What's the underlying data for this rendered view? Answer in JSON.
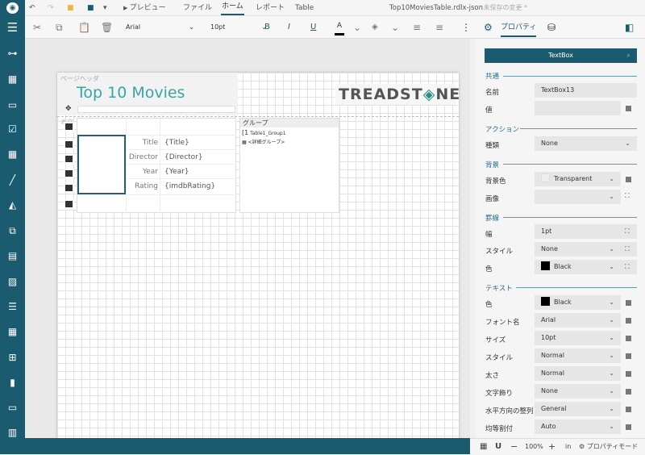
{
  "topbar": {
    "preview": "プレビュー",
    "tabs": [
      "ファイル",
      "ホーム",
      "レポート",
      "Table"
    ],
    "active_tab": "ホーム",
    "filename": "Top10MoviesTable.rdlx-json",
    "unsaved": "* 未保存の変更 *"
  },
  "toolbar": {
    "font": "Arial",
    "size": "10pt",
    "bold": "B",
    "italic": "I",
    "underline": "U"
  },
  "report": {
    "page_header_label": "ページヘッダ",
    "title": "Top 10 Movies",
    "logo": "TREADSTONE",
    "body_label": "本文",
    "rows": [
      {
        "label": "Title",
        "value": "{Title}"
      },
      {
        "label": "Director",
        "value": "{Director}"
      },
      {
        "label": "Year",
        "value": "{Year}"
      },
      {
        "label": "Rating",
        "value": "{imdbRating}"
      }
    ],
    "groups": {
      "header": "グループ",
      "group1": "Table1_Group1",
      "group1_prefix": "[1",
      "detail": "<詳細グループ>"
    }
  },
  "props": {
    "tab": "プロパティ",
    "object_type": "TextBox",
    "sections": {
      "common": "共通",
      "action": "アクション",
      "background": "背景",
      "border": "罫線",
      "text": "テキスト"
    },
    "name_label": "名前",
    "name_value": "TextBox13",
    "value_label": "値",
    "action_type_label": "種類",
    "action_type": "None",
    "bgcolor_label": "背景色",
    "bgcolor": "Transparent",
    "image_label": "画像",
    "border_width_label": "幅",
    "border_width": "1pt",
    "border_style_label": "スタイル",
    "border_style": "None",
    "border_color_label": "色",
    "border_color": "Black",
    "text_color_label": "色",
    "text_color": "Black",
    "font_name_label": "フォント名",
    "font_name": "Arial",
    "font_size_label": "サイズ",
    "font_size": "10pt",
    "font_style_label": "スタイル",
    "font_style": "Normal",
    "weight_label": "太さ",
    "weight": "Normal",
    "decoration_label": "文字飾り",
    "decoration": "None",
    "halign_label": "水平方向の整列",
    "halign": "General",
    "justify_label": "均等割付",
    "justify": "Auto"
  },
  "status": {
    "zoom": "100%",
    "unit": "in",
    "mode": "プロパティモード"
  },
  "colors": {
    "sidebar": "#1b5b6f",
    "accent": "#1b5b6f",
    "title": "#3aa3a8"
  }
}
